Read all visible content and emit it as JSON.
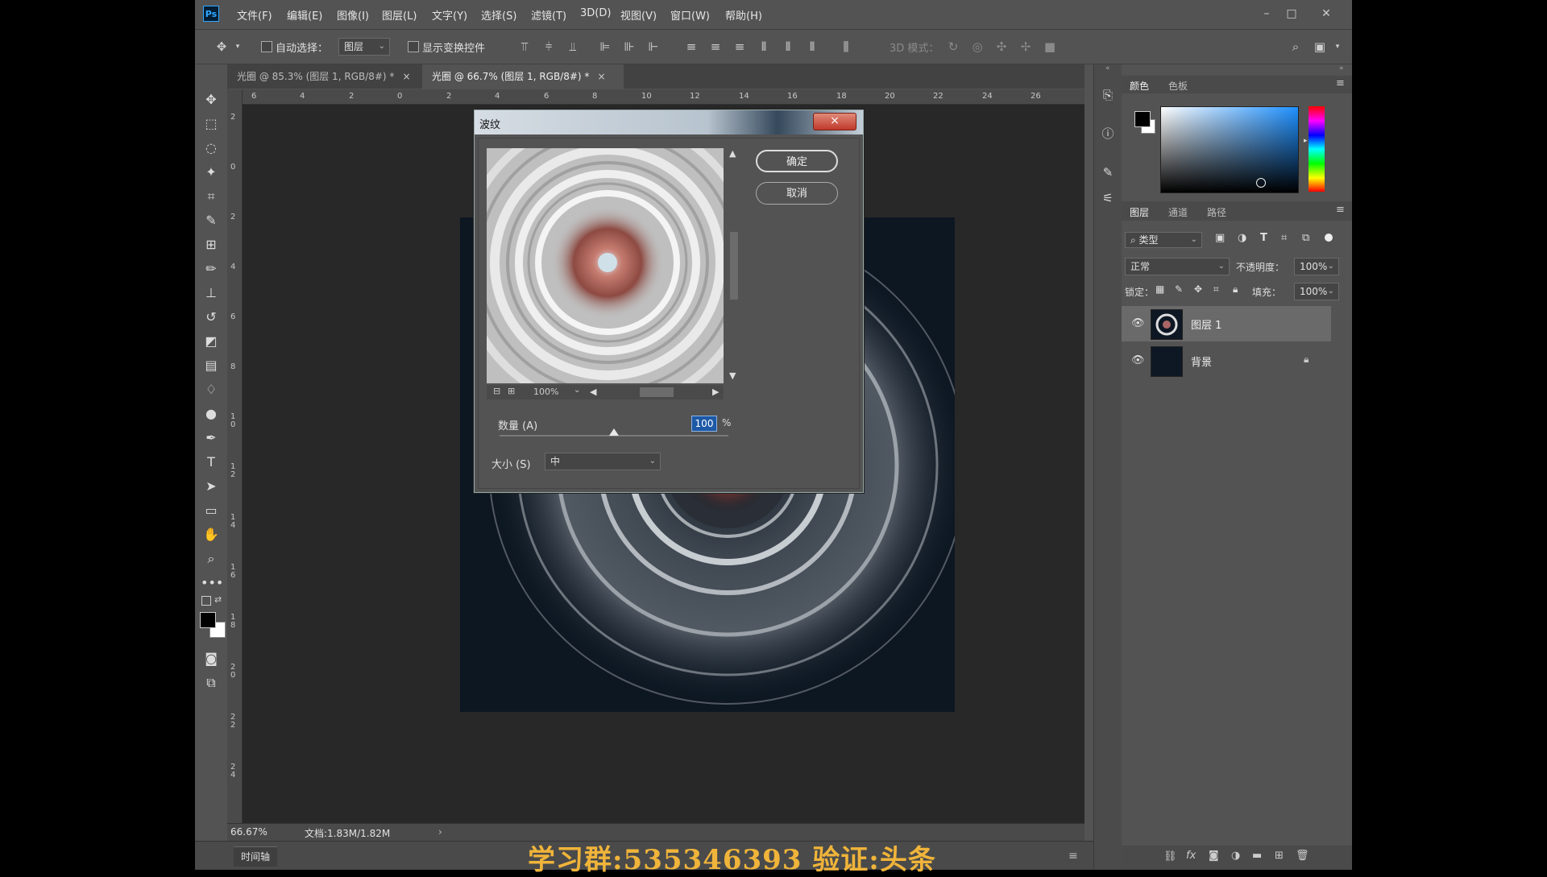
{
  "menubar": {
    "app_icon": "Ps",
    "items": [
      "文件(F)",
      "编辑(E)",
      "图像(I)",
      "图层(L)",
      "文字(Y)",
      "选择(S)",
      "滤镜(T)",
      "3D(D)",
      "视图(V)",
      "窗口(W)",
      "帮助(H)"
    ]
  },
  "options": {
    "auto_select_label": "自动选择：",
    "auto_select_value": "图层",
    "show_transform_label": "显示变换控件",
    "mode_3d_label": "3D 模式："
  },
  "tabs": [
    {
      "label": "光圈 @ 85.3% (图层 1, RGB/8#) *",
      "close": "×"
    },
    {
      "label": "光圈 @ 66.7% (图层 1, RGB/8#) *",
      "close": "×"
    }
  ],
  "ruler_top": [
    "6",
    "4",
    "2",
    "0",
    "2",
    "4",
    "6",
    "8",
    "10",
    "12",
    "14",
    "16",
    "18",
    "20",
    "22",
    "24",
    "26"
  ],
  "ruler_left": [
    "2",
    "0",
    "2",
    "4",
    "6",
    "8",
    "1 0",
    "1 2",
    "1 4",
    "1 6",
    "1 8",
    "2 0",
    "2 2",
    "2 4"
  ],
  "status": {
    "zoom": "66.67%",
    "doc_info": "文档:1.83M/1.82M",
    "arrow": "›"
  },
  "timeline_label": "时间轴",
  "color_panel": {
    "tabs": [
      "颜色",
      "色板"
    ],
    "hue_color": "#1e90ff"
  },
  "layers_panel": {
    "tabs": [
      "图层",
      "通道",
      "路径"
    ],
    "filter_label": "类型",
    "blend_mode": "正常",
    "opacity_label": "不透明度：",
    "opacity_value": "100%",
    "lock_label": "锁定：",
    "fill_label": "填充：",
    "fill_value": "100%",
    "layers": [
      {
        "name": "图层 1",
        "selected": true
      },
      {
        "name": "背景",
        "selected": false,
        "locked": true
      }
    ]
  },
  "dialog": {
    "title": "波纹",
    "close": "×",
    "ok_label": "确定",
    "cancel_label": "取消",
    "preview_zoom": "100%",
    "amount_label": "数量 (A)",
    "amount_value": "100",
    "amount_unit": "%",
    "amount_fraction": 0.5,
    "size_label": "大小 (S)",
    "size_value": "中"
  },
  "watermark": "学习群:535346393    验证:头条"
}
